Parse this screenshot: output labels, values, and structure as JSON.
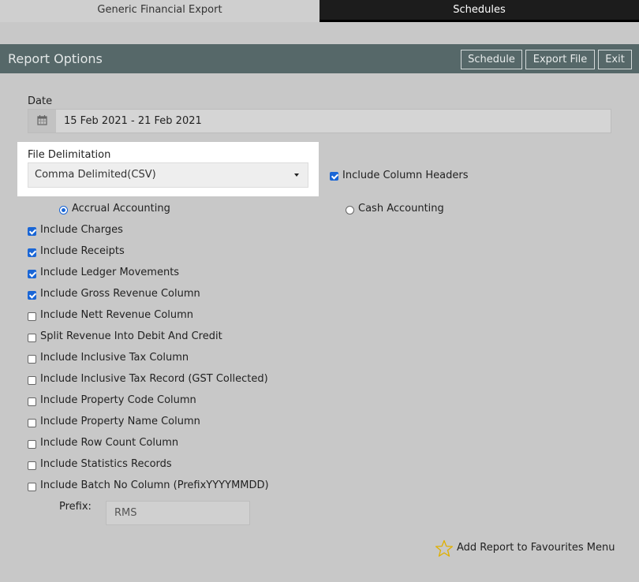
{
  "tabs": [
    {
      "label": "Generic Financial Export"
    },
    {
      "label": "Schedules"
    }
  ],
  "header": {
    "title": "Report Options",
    "buttons": {
      "schedule": "Schedule",
      "export": "Export File",
      "exit": "Exit"
    }
  },
  "date": {
    "label": "Date",
    "value": "15 Feb 2021 - 21 Feb 2021",
    "icon": "calendar-icon"
  },
  "file_delimitation": {
    "label": "File Delimitation",
    "selected": "Comma Delimited(CSV)"
  },
  "include_column_headers": {
    "label": "Include Column Headers",
    "checked": true
  },
  "accounting": {
    "accrual": {
      "label": "Accrual Accounting",
      "selected": true
    },
    "cash": {
      "label": "Cash Accounting",
      "selected": false
    }
  },
  "options": [
    {
      "label": "Include Charges",
      "checked": true
    },
    {
      "label": "Include Receipts",
      "checked": true
    },
    {
      "label": "Include Ledger Movements",
      "checked": true
    },
    {
      "label": "Include Gross Revenue Column",
      "checked": true
    },
    {
      "label": "Include Nett Revenue Column",
      "checked": false
    },
    {
      "label": "Split Revenue Into Debit And Credit",
      "checked": false
    },
    {
      "label": "Include Inclusive Tax Column",
      "checked": false
    },
    {
      "label": "Include Inclusive Tax Record (GST Collected)",
      "checked": false
    },
    {
      "label": "Include Property Code Column",
      "checked": false
    },
    {
      "label": "Include Property Name Column",
      "checked": false
    },
    {
      "label": "Include Row Count Column",
      "checked": false
    },
    {
      "label": "Include Statistics Records",
      "checked": false
    },
    {
      "label": "Include Batch No Column (PrefixYYYYMMDD)",
      "checked": false
    }
  ],
  "prefix": {
    "label": "Prefix:",
    "value": "RMS"
  },
  "favourites": {
    "label": "Add Report to Favourites Menu",
    "icon": "star-icon"
  },
  "colors": {
    "header": "#566869",
    "accent": "#1a66d6",
    "star": "#e0b000"
  }
}
